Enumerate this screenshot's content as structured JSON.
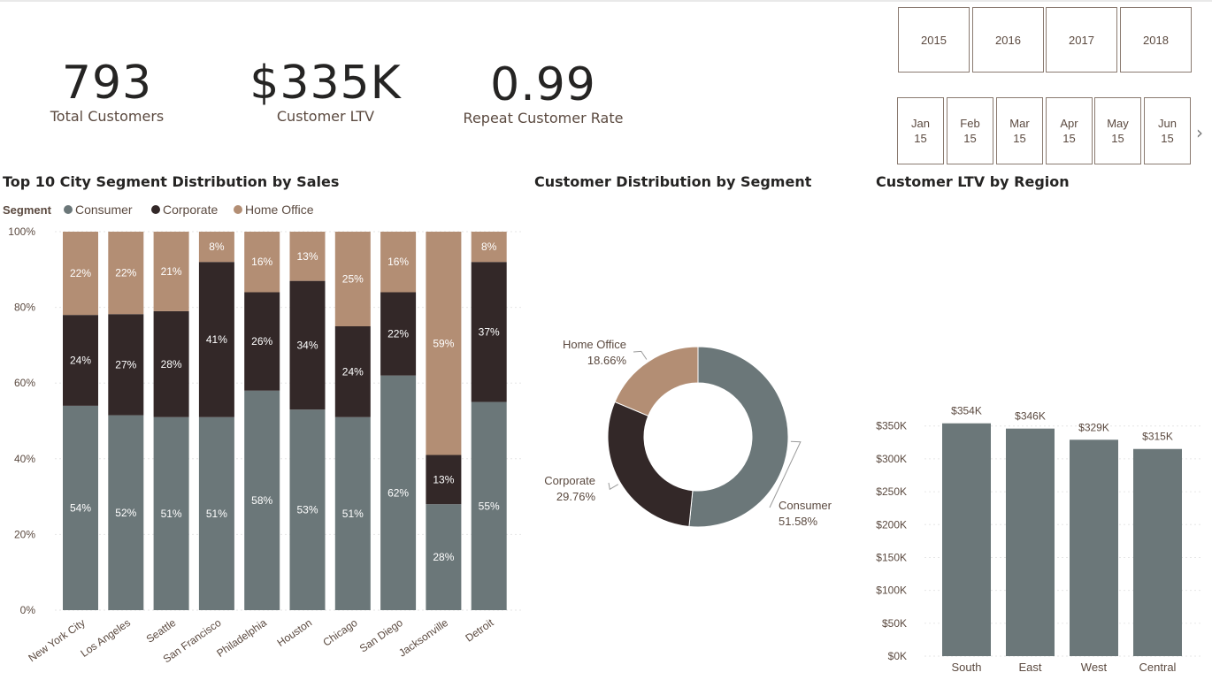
{
  "kpis": [
    {
      "value": "793",
      "label": "Total Customers"
    },
    {
      "value": "$335K",
      "label": "Customer LTV"
    },
    {
      "value": "0.99",
      "label": "Repeat Customer Rate"
    }
  ],
  "slicers": {
    "years": [
      "2015",
      "2016",
      "2017",
      "2018"
    ],
    "months": [
      {
        "m": "Jan",
        "y": "15"
      },
      {
        "m": "Feb",
        "y": "15"
      },
      {
        "m": "Mar",
        "y": "15"
      },
      {
        "m": "Apr",
        "y": "15"
      },
      {
        "m": "May",
        "y": "15"
      },
      {
        "m": "Jun",
        "y": "15"
      }
    ],
    "next_glyph": "›"
  },
  "colors": {
    "consumer": "#6b7779",
    "corporate": "#332828",
    "home_office": "#b38e74"
  },
  "chart_data": [
    {
      "type": "bar",
      "stacked": "100%",
      "title": "Top 10 City Segment Distribution by Sales",
      "legend_title": "Segment",
      "legend_position": "top-left",
      "categories": [
        "New York City",
        "Los Angeles",
        "Seattle",
        "San Francisco",
        "Philadelphia",
        "Houston",
        "Chicago",
        "San Diego",
        "Jacksonville",
        "Detroit"
      ],
      "series": [
        {
          "name": "Consumer",
          "values": [
            54,
            52,
            51,
            51,
            58,
            53,
            51,
            62,
            28,
            55
          ]
        },
        {
          "name": "Corporate",
          "values": [
            24,
            27,
            28,
            41,
            26,
            34,
            24,
            22,
            13,
            37
          ]
        },
        {
          "name": "Home Office",
          "values": [
            22,
            22,
            21,
            8,
            16,
            13,
            25,
            16,
            59,
            8
          ]
        }
      ],
      "y_ticks": [
        "0%",
        "20%",
        "40%",
        "60%",
        "80%",
        "100%"
      ],
      "ylim": [
        0,
        100
      ]
    },
    {
      "type": "pie",
      "donut": true,
      "title": "Customer Distribution by Segment",
      "slices": [
        {
          "name": "Consumer",
          "value": 51.58,
          "label": "51.58%"
        },
        {
          "name": "Corporate",
          "value": 29.76,
          "label": "29.76%"
        },
        {
          "name": "Home Office",
          "value": 18.66,
          "label": "18.66%"
        }
      ]
    },
    {
      "type": "bar",
      "title": "Customer LTV by Region",
      "categories": [
        "South",
        "East",
        "West",
        "Central"
      ],
      "values": [
        354,
        346,
        329,
        315
      ],
      "data_labels": [
        "$354K",
        "$346K",
        "$329K",
        "$315K"
      ],
      "y_ticks": [
        "$0K",
        "$50K",
        "$100K",
        "$150K",
        "$200K",
        "$250K",
        "$300K",
        "$350K"
      ],
      "ylim": [
        0,
        354
      ]
    }
  ]
}
